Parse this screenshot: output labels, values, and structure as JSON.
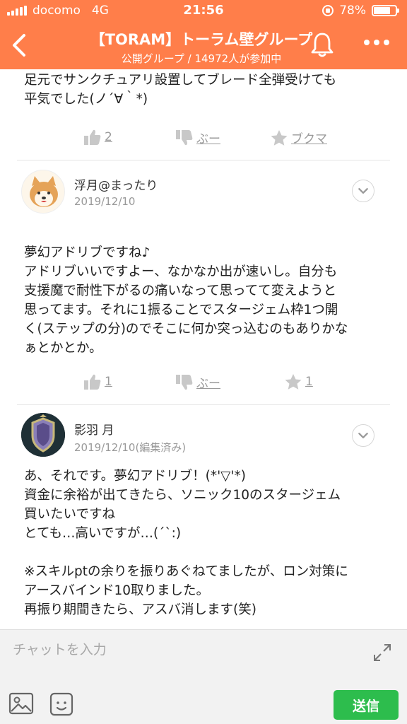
{
  "status": {
    "carrier": "docomo",
    "network": "4G",
    "time": "21:56",
    "battery": "78%",
    "battery_level": 0.78
  },
  "header": {
    "title": "【TORAM】トーラム壁グループ",
    "subtitle": "公開グループ / 14972人が参加中",
    "back_icon": "chevron-left-icon",
    "bell_icon": "bell-icon",
    "more_icon": "more-dots-icon",
    "color": "#ff7e4a"
  },
  "posts": [
    {
      "text": "足元でサンクチュアリ設置してブレード全弾受けても\n平気でした(ノ´∀｀*)",
      "like": "2",
      "boo": "ぶー",
      "bookmark": "ブクマ"
    },
    {
      "user": "浮月@まったり",
      "date": "2019/12/10",
      "text": "夢幻アドリブですね♪\nアドリブいいですよー、なかなか出が速いし。自分も\n支援魔で耐性下がるの痛いなって思ってて変えようと\n思ってます。それに1振ることでスタージェム枠1つ開\nく(ステップの分)のでそこに何か突っ込むのもありかな\nぁとかとか。",
      "like": "1",
      "boo": "ぶー",
      "bookmark": "1"
    },
    {
      "user": "影羽 月",
      "date": "2019/12/10(編集済み)",
      "text": "あ、それです。夢幻アドリブ！(*'▽'*)\n資金に余裕が出てきたら、ソニック10のスタージェム\n買いたいですね\nとても…高いですが…(´`:)\n\n※スキルptの余りを振りあぐねてましたが、ロン対策に\nアースバインド10取りました。\n再振り期間きたら、アスバ消します(笑)"
    }
  ],
  "input": {
    "placeholder": "チャットを入力",
    "send_label": "送信",
    "send_color": "#2dbd4d"
  }
}
